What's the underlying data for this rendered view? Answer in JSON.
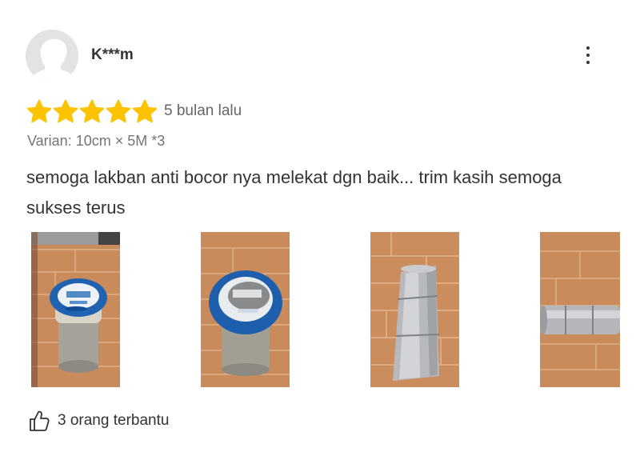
{
  "review": {
    "username": "K***m",
    "rating": 5,
    "rating_max": 5,
    "time": "5 bulan lalu",
    "variant": "Varian: 10cm × 5M  *3",
    "comment": "semoga lakban anti bocor nya melekat dgn baik... trim kasih semoga sukses terus",
    "helpful": "3 orang terbantu"
  },
  "colors": {
    "star": "#FDC300",
    "text": "#333333",
    "muted": "#757575"
  },
  "icons": [
    "avatar-placeholder-icon",
    "more-vertical-icon",
    "star-icon",
    "thumbs-up-icon"
  ]
}
